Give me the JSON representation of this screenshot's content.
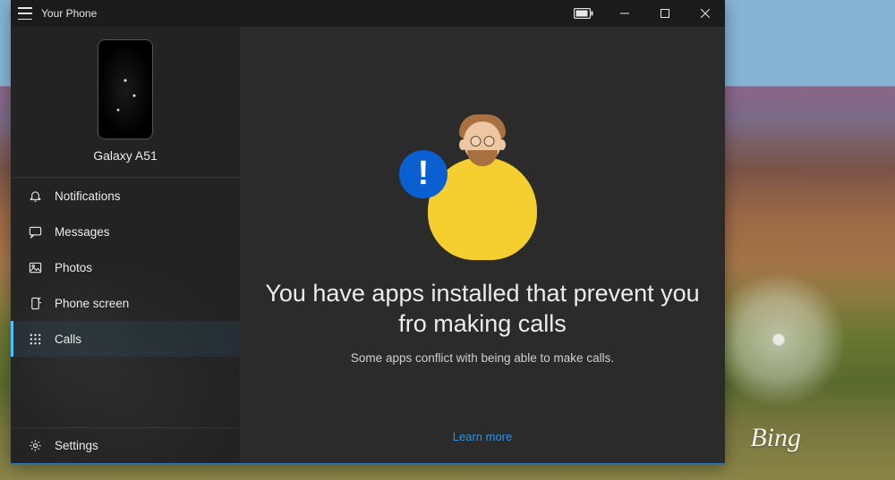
{
  "app": {
    "title": "Your Phone"
  },
  "desktop": {
    "brand": "Bing"
  },
  "device": {
    "name": "Galaxy A51"
  },
  "nav": {
    "items": [
      {
        "label": "Notifications"
      },
      {
        "label": "Messages"
      },
      {
        "label": "Photos"
      },
      {
        "label": "Phone screen"
      },
      {
        "label": "Calls"
      }
    ]
  },
  "settings": {
    "label": "Settings"
  },
  "main": {
    "heading": "You have apps installed that prevent you fro making calls",
    "subtext": "Some apps conflict with being able to make calls.",
    "learn_more": "Learn more"
  }
}
